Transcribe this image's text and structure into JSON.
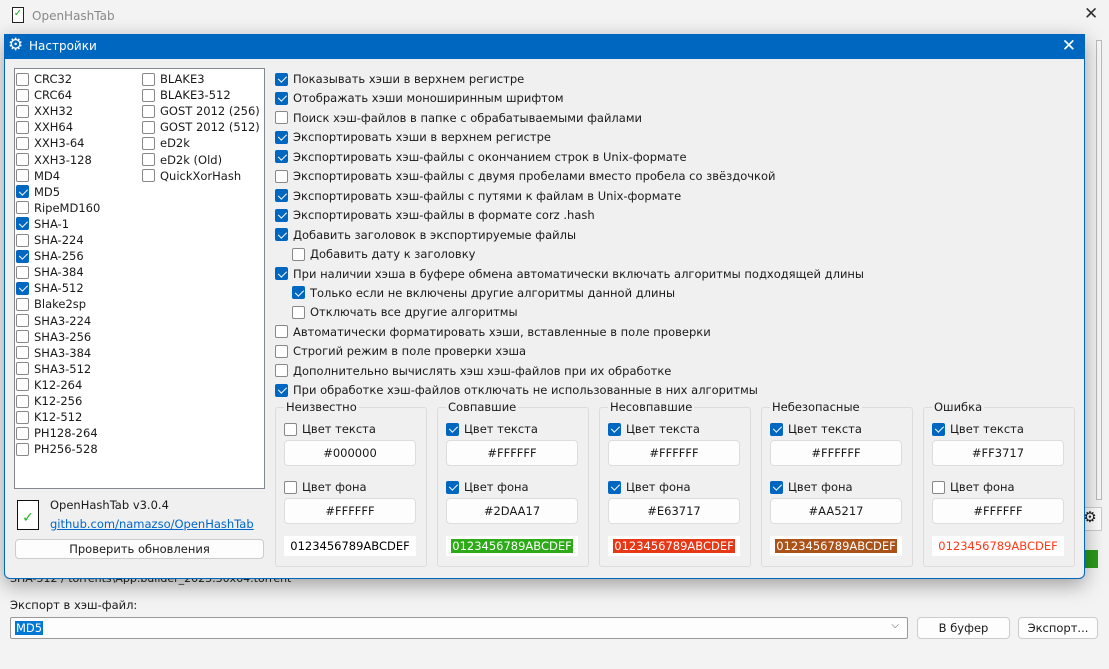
{
  "main": {
    "title": "OpenHashTab",
    "path_text": "SHA-512 / torrents\\App.builder_2023.30x64.torrent",
    "export_label": "Экспорт в хэш-файл:",
    "export_value": "MD5",
    "to_clipboard": "В буфер",
    "export_button": "Экспорт..."
  },
  "dialog": {
    "title": "Настройки",
    "algorithms_col1": [
      {
        "label": "CRC32",
        "checked": false
      },
      {
        "label": "CRC64",
        "checked": false
      },
      {
        "label": "XXH32",
        "checked": false
      },
      {
        "label": "XXH64",
        "checked": false
      },
      {
        "label": "XXH3-64",
        "checked": false
      },
      {
        "label": "XXH3-128",
        "checked": false
      },
      {
        "label": "MD4",
        "checked": false
      },
      {
        "label": "MD5",
        "checked": true
      },
      {
        "label": "RipeMD160",
        "checked": false
      },
      {
        "label": "SHA-1",
        "checked": true
      },
      {
        "label": "SHA-224",
        "checked": false
      },
      {
        "label": "SHA-256",
        "checked": true
      },
      {
        "label": "SHA-384",
        "checked": false
      },
      {
        "label": "SHA-512",
        "checked": true
      },
      {
        "label": "Blake2sp",
        "checked": false
      },
      {
        "label": "SHA3-224",
        "checked": false
      },
      {
        "label": "SHA3-256",
        "checked": false
      },
      {
        "label": "SHA3-384",
        "checked": false
      },
      {
        "label": "SHA3-512",
        "checked": false
      },
      {
        "label": "K12-264",
        "checked": false
      },
      {
        "label": "K12-256",
        "checked": false
      },
      {
        "label": "K12-512",
        "checked": false
      },
      {
        "label": "PH128-264",
        "checked": false
      },
      {
        "label": "PH256-528",
        "checked": false
      }
    ],
    "algorithms_col2": [
      {
        "label": "BLAKE3",
        "checked": false
      },
      {
        "label": "BLAKE3-512",
        "checked": false
      },
      {
        "label": "GOST 2012 (256)",
        "checked": false
      },
      {
        "label": "GOST 2012 (512)",
        "checked": false
      },
      {
        "label": "eD2k",
        "checked": false
      },
      {
        "label": "eD2k (Old)",
        "checked": false
      },
      {
        "label": "QuickXorHash",
        "checked": false
      }
    ],
    "options": [
      {
        "label": "Показывать хэши в верхнем регистре",
        "checked": true,
        "indent": 0
      },
      {
        "label": "Отображать хэши моноширинным шрифтом",
        "checked": true,
        "indent": 0
      },
      {
        "label": "Поиск хэш-файлов в папке с обрабатываемыми файлами",
        "checked": false,
        "indent": 0
      },
      {
        "label": "Экспортировать хэши в верхнем регистре",
        "checked": true,
        "indent": 0
      },
      {
        "label": "Экспортировать хэш-файлы с окончанием строк в Unix-формате",
        "checked": true,
        "indent": 0
      },
      {
        "label": "Экспортировать хэш-файлы с двумя пробелами вместо пробела со звёздочкой",
        "checked": false,
        "indent": 0
      },
      {
        "label": "Экспортировать хэш-файлы с путями к файлам в Unix-формате",
        "checked": true,
        "indent": 0
      },
      {
        "label": "Экспортировать хэш-файлы в формате corz .hash",
        "checked": true,
        "indent": 0
      },
      {
        "label": "Добавить заголовок в экспортируемые файлы",
        "checked": true,
        "indent": 0
      },
      {
        "label": "Добавить дату к заголовку",
        "checked": false,
        "indent": 1
      },
      {
        "label": "При наличии хэша в буфере обмена автоматически включать алгоритмы подходящей длины",
        "checked": true,
        "indent": 0
      },
      {
        "label": "Только если не включены другие алгоритмы данной длины",
        "checked": true,
        "indent": 1
      },
      {
        "label": "Отключать все другие алгоритмы",
        "checked": false,
        "indent": 1
      },
      {
        "label": "Автоматически форматировать хэши, вставленные в поле проверки",
        "checked": false,
        "indent": 0
      },
      {
        "label": "Строгий режим в поле проверки хэша",
        "checked": false,
        "indent": 0
      },
      {
        "label": "Дополнительно вычислять хэш хэш-файлов при их обработке",
        "checked": false,
        "indent": 0
      },
      {
        "label": "При обработке хэш-файлов отключать не использованные в них алгоритмы",
        "checked": true,
        "indent": 0
      }
    ],
    "text_color_label": "Цвет текста",
    "bg_color_label": "Цвет фона",
    "sample": "0123456789ABCDEF",
    "groups": [
      {
        "title": "Неизвестно",
        "fg_on": false,
        "fg": "#000000",
        "bg_on": false,
        "bg": "#FFFFFF",
        "preview_fg": "#000000",
        "preview_bg": "#FFFFFF"
      },
      {
        "title": "Совпавшие",
        "fg_on": true,
        "fg": "#FFFFFF",
        "bg_on": true,
        "bg": "#2DAA17",
        "preview_fg": "#FFFFFF",
        "preview_bg": "#2DAA17"
      },
      {
        "title": "Несовпавшие",
        "fg_on": true,
        "fg": "#FFFFFF",
        "bg_on": true,
        "bg": "#E63717",
        "preview_fg": "#FFFFFF",
        "preview_bg": "#E63717"
      },
      {
        "title": "Небезопасные",
        "fg_on": true,
        "fg": "#FFFFFF",
        "bg_on": true,
        "bg": "#AA5217",
        "preview_fg": "#FFFFFF",
        "preview_bg": "#AA5217"
      },
      {
        "title": "Ошибка",
        "fg_on": true,
        "fg": "#FF3717",
        "bg_on": false,
        "bg": "#FFFFFF",
        "preview_fg": "#FF3717",
        "preview_bg": "#FFFFFF"
      }
    ],
    "about": {
      "version": "OpenHashTab v3.0.4",
      "link": "github.com/namazso/OpenHashTab",
      "check_updates": "Проверить обновления"
    }
  }
}
